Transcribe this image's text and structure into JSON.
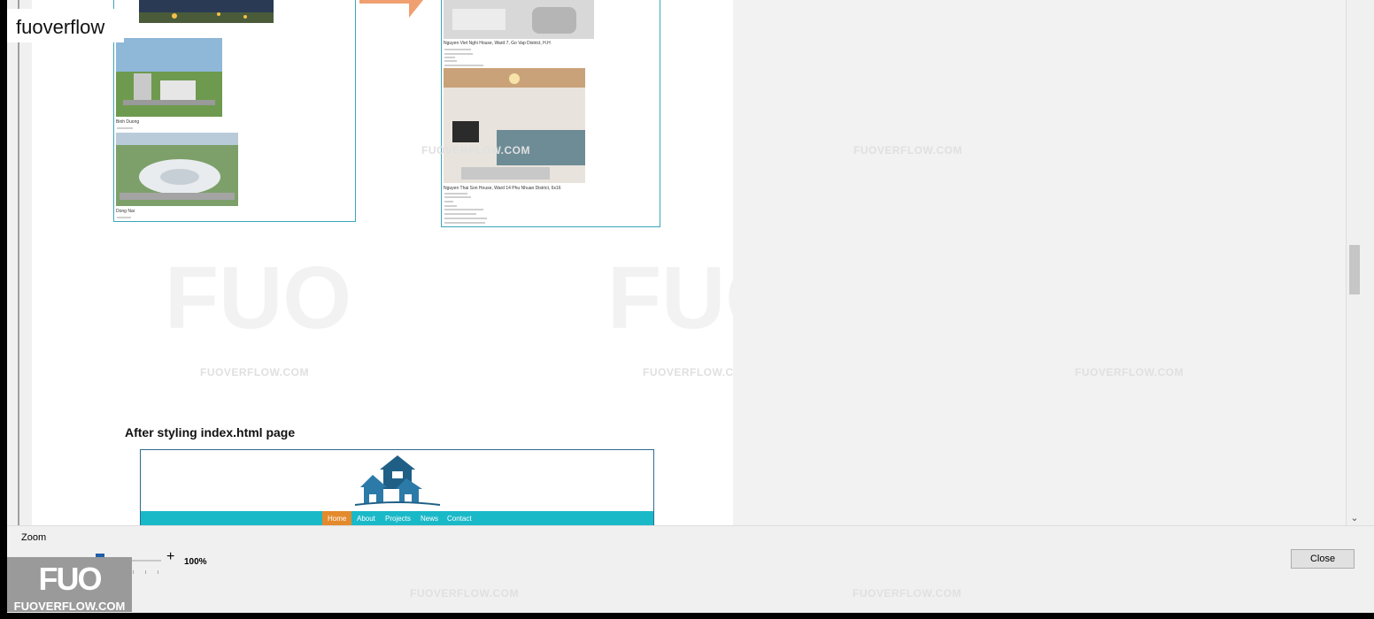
{
  "brand": {
    "tag": "fuoverflow",
    "logo_mark": "FUO",
    "logo_url": "FUOVERFLOW.COM"
  },
  "watermark": {
    "text": "FUOVERFLOW.COM",
    "mark": "FUO"
  },
  "document": {
    "captions": {
      "binh_duong": "Binh Duong",
      "dong_nai": "Dong Nai",
      "house1": "Nguyen Viet Nghi House, Ward 7, Go Vap District, H.H",
      "house2": "Nguyen Thai Son House, Ward 14 Phu Nhuan District, 6x16"
    },
    "heading": "After styling index.html page",
    "site_nav": [
      "Home",
      "About",
      "Projects",
      "News",
      "Contact"
    ]
  },
  "controls": {
    "zoom_label": "Zoom",
    "zoom_minus": "-",
    "zoom_plus": "+",
    "zoom_value": "100%",
    "close_label": "Close"
  },
  "colors": {
    "frame": "#3aa6ba",
    "nav": "#1ab9c8",
    "nav_active": "#e38a2c",
    "knob": "#1e5fa8"
  }
}
